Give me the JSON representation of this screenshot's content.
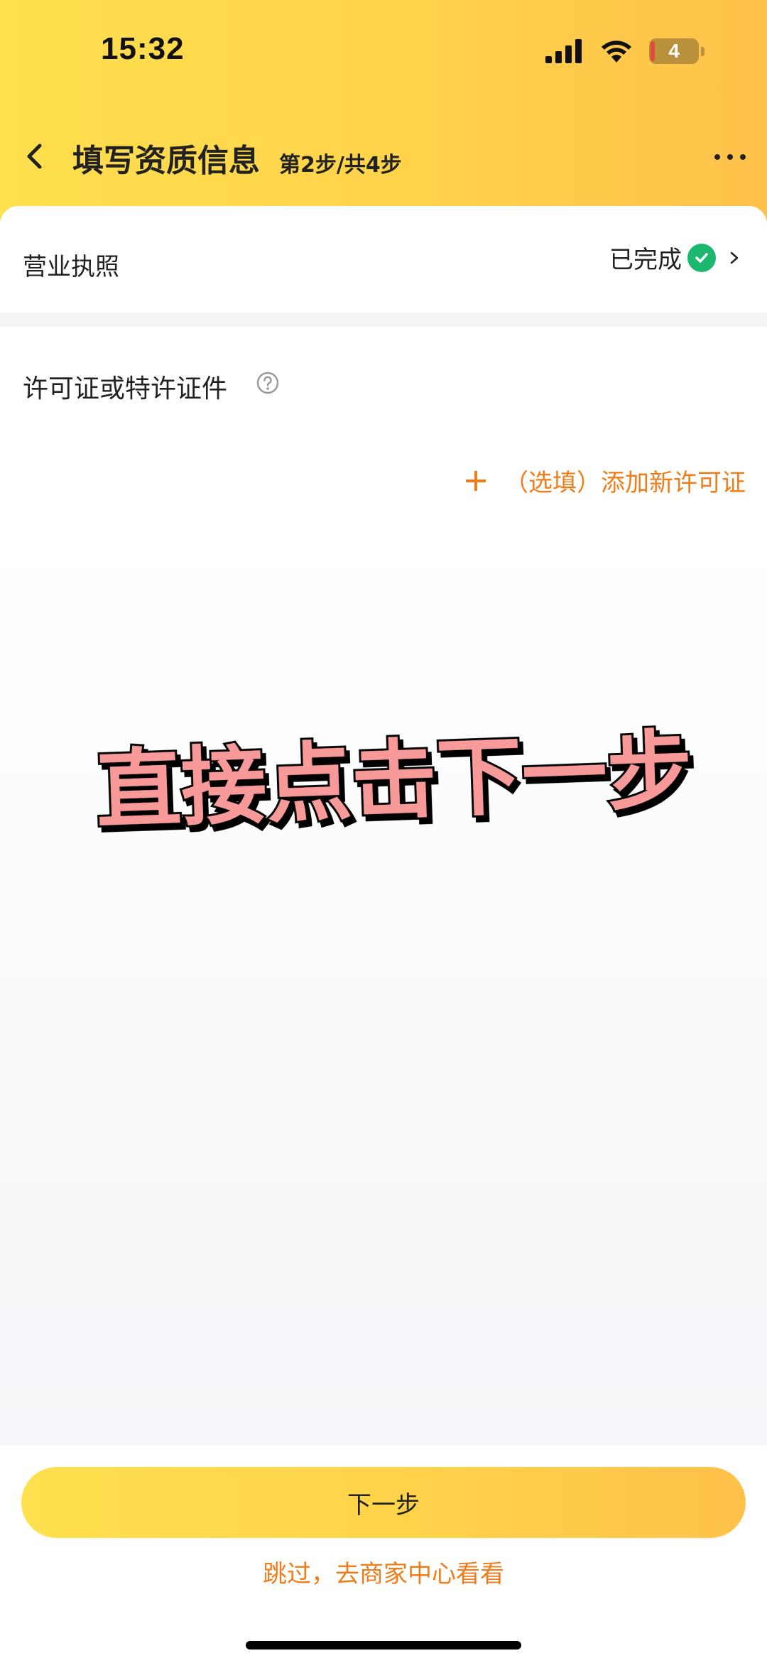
{
  "status_bar": {
    "time": "15:32",
    "battery": "4"
  },
  "nav": {
    "title": "填写资质信息",
    "step": "第2步/共4步"
  },
  "business_license": {
    "label": "营业执照",
    "status": "已完成"
  },
  "permit": {
    "title": "许可证或特许证件",
    "add_label": "（选填）添加新许可证"
  },
  "overlay": {
    "text": "直接点击下一步"
  },
  "footer": {
    "next_label": "下一步",
    "skip_label": "跳过，去商家中心看看"
  },
  "colors": {
    "accent_yellow": "#ffd24a",
    "link_orange": "#f07d1a",
    "success_green": "#1db870",
    "overlay_pink": "#f99a9a"
  }
}
